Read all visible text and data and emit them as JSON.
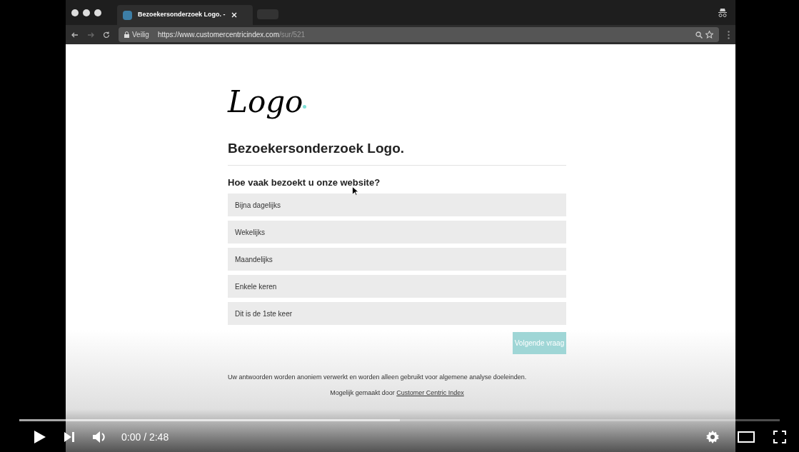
{
  "browser": {
    "tab_title": "Bezoekersonderzoek Logo. -",
    "secure_label": "Veilig",
    "url_main": "https://www.customercentricindex.com",
    "url_path": "/sur/521"
  },
  "page": {
    "logo": "Logo",
    "title": "Bezoekersonderzoek Logo.",
    "question": "Hoe vaak bezoekt u onze website?",
    "options": [
      {
        "label": "Bijna dagelijks",
        "selected": false
      },
      {
        "label": "Wekelijks",
        "selected": false
      },
      {
        "label": "Maandelijks",
        "selected": false
      },
      {
        "label": "Enkele keren",
        "selected": false
      },
      {
        "label": "Dit is de 1ste keer",
        "selected": false
      }
    ],
    "next_button": {
      "label": "Volgende vraag",
      "disabled": true
    },
    "notice": "Uw antwoorden worden anoniem verwerkt en worden alleen gebruikt voor algemene analyse doeleinden.",
    "credit": "Mogelijk gemaakt door",
    "credit_link": "Customer Centric Index"
  },
  "player": {
    "time": "0:00 / 2:48",
    "level": 0.5
  }
}
